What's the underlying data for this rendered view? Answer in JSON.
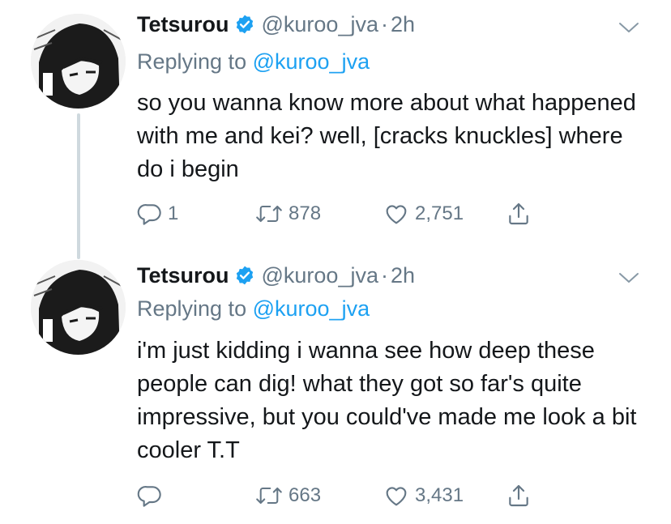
{
  "tweets": [
    {
      "author_name": "Tetsurou",
      "handle": "@kuroo_jva",
      "separator": "·",
      "time": "2h",
      "replying_prefix": "Replying to",
      "replying_to": "@kuroo_jva",
      "text": "so you wanna know more about what happened with me and kei? well, [cracks knuckles] where do i begin",
      "reply_count": "1",
      "retweet_count": "878",
      "like_count": "2,751"
    },
    {
      "author_name": "Tetsurou",
      "handle": "@kuroo_jva",
      "separator": "·",
      "time": "2h",
      "replying_prefix": "Replying to",
      "replying_to": "@kuroo_jva",
      "text": "i'm just kidding i wanna see how deep these people can dig! what they got so far's quite impressive, but you could've made me look a bit cooler T.T",
      "reply_count": "",
      "retweet_count": "663",
      "like_count": "3,431"
    }
  ],
  "colors": {
    "text": "#14171a",
    "secondary": "#657786",
    "accent": "#1da1f2",
    "thread_line": "#cfd9de"
  },
  "icons": [
    "verified-badge-icon",
    "chevron-down-icon",
    "reply-icon",
    "retweet-icon",
    "like-icon",
    "share-icon"
  ]
}
